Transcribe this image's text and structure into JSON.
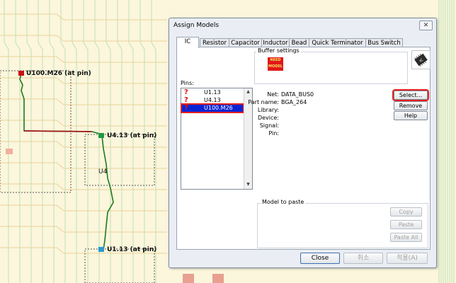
{
  "pcb": {
    "labels": [
      "U100.M26 (at pin)",
      "U4.13 (at pin)",
      "U4",
      "U1.13 (at pin)"
    ]
  },
  "dialog": {
    "title": "Assign Models",
    "close_glyph": "✕",
    "tabs": [
      "IC",
      "Resistor",
      "Capacitor",
      "Inductor",
      "Bead",
      "Quick Terminator",
      "Bus Switch"
    ],
    "active_tab": "IC",
    "buffer_settings_label": "Buffer settings",
    "no_model_badge": "NEED MODEL",
    "ic_icon_text": "IC",
    "pins_label": "Pins:",
    "pins": [
      {
        "flag": "?",
        "name": "U1.13",
        "selected": false
      },
      {
        "flag": "?",
        "name": "U4.13",
        "selected": false
      },
      {
        "flag": "?",
        "name": "U100.M26",
        "selected": true
      }
    ],
    "info": {
      "net_label": "Net:",
      "net_value": "DATA_BUS0",
      "part_label": "Part name:",
      "part_value": "BGA_264",
      "library_label": "Library:",
      "device_label": "Device:",
      "signal_label": "Signal:",
      "pin_label": "Pin:"
    },
    "buttons": {
      "select": "Select...",
      "remove": "Remove",
      "help": "Help"
    },
    "model_to_paste_label": "Model to paste",
    "paste_buttons": {
      "copy": "Copy",
      "paste": "Paste",
      "paste_all": "Paste All"
    },
    "footer": {
      "close": "Close",
      "cancel": "취소",
      "apply": "적용(A)"
    }
  },
  "colors": {
    "selection": "#0a24d4",
    "highlight": "#e52020",
    "warning_flag": "#e01010",
    "net_green": "#1e7a1e",
    "net_red": "#a01818"
  }
}
